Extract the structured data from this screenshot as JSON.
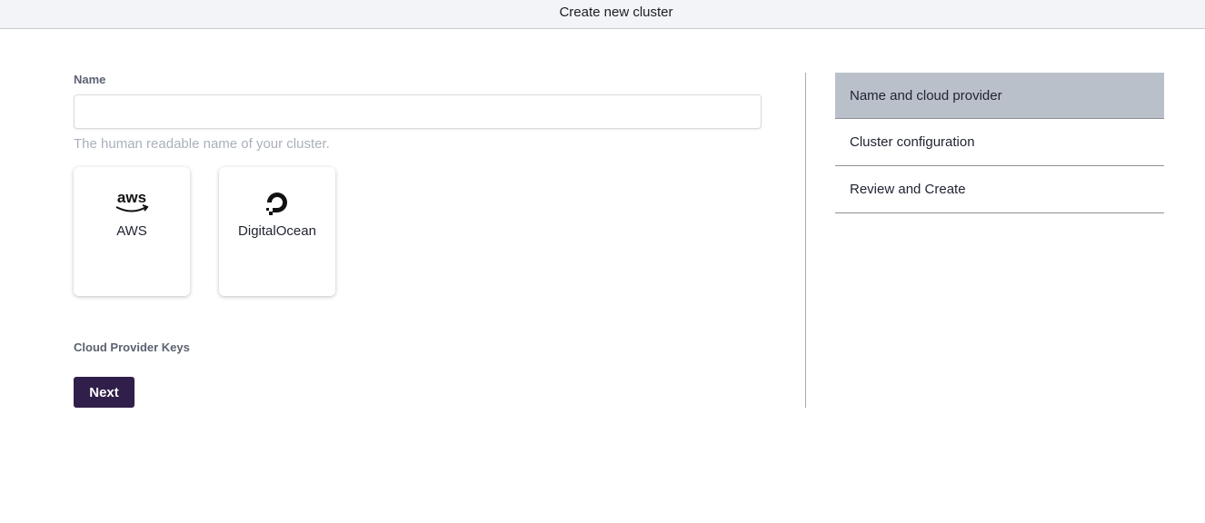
{
  "header": {
    "title": "Create new cluster"
  },
  "form": {
    "name_label": "Name",
    "name_value": "",
    "name_placeholder": "",
    "name_help": "The human readable name of your cluster.",
    "providers": [
      {
        "name": "AWS",
        "icon": "aws-logo-icon"
      },
      {
        "name": "DigitalOcean",
        "icon": "digitalocean-logo-icon"
      }
    ],
    "keys_label": "Cloud Provider Keys",
    "next_label": "Next"
  },
  "steps": [
    {
      "label": "Name and cloud provider",
      "active": true
    },
    {
      "label": "Cluster configuration",
      "active": false
    },
    {
      "label": "Review and Create",
      "active": false
    }
  ],
  "colors": {
    "primary_button": "#2f1f4a",
    "active_step": "#b9c0ca",
    "topbar_bg": "#f2f4f7"
  }
}
